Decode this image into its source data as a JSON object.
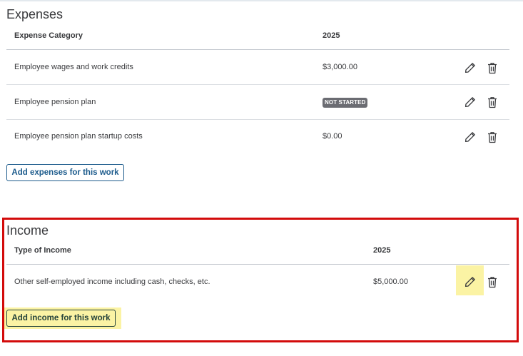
{
  "expenses": {
    "title": "Expenses",
    "col_category": "Expense Category",
    "col_year": "2025",
    "rows": [
      {
        "label": "Employee wages and work credits",
        "value": "$3,000.00"
      },
      {
        "label": "Employee pension plan",
        "badge": "NOT STARTED"
      },
      {
        "label": "Employee pension plan startup costs",
        "value": "$0.00"
      }
    ],
    "add_button": "Add expenses for this work"
  },
  "income": {
    "title": "Income",
    "col_type": "Type of Income",
    "col_year": "2025",
    "rows": [
      {
        "label": "Other self-employed income including cash, checks, etc.",
        "value": "$5,000.00"
      }
    ],
    "add_button": "Add income for this work"
  },
  "icons": [
    "pencil-icon",
    "trash-icon"
  ],
  "colors": {
    "highlight_frame": "#d30b0b",
    "highlight_fill": "#fbf3a4",
    "button_blue": "#1c5b8c",
    "badge_grey": "#6b6c72"
  }
}
